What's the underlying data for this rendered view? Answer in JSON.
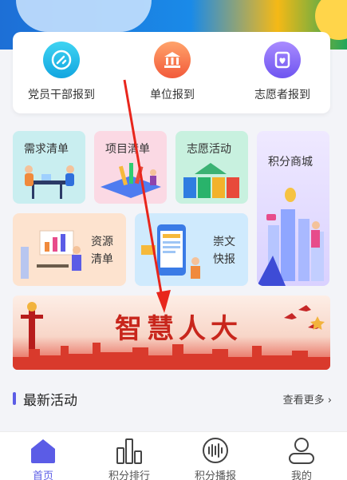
{
  "colors": {
    "accent": "#5b5ce6",
    "arrow": "#e8261c"
  },
  "report": {
    "items": [
      {
        "label": "党员干部报到",
        "icon": "party-member-icon"
      },
      {
        "label": "单位报到",
        "icon": "building-icon"
      },
      {
        "label": "志愿者报到",
        "icon": "volunteer-heart-icon"
      }
    ]
  },
  "tiles": {
    "demand": "需求清单",
    "project": "项目清单",
    "volunteer": "志愿活动",
    "points_mall": "积分商城",
    "resource_line1": "资源",
    "resource_line2": "清单",
    "culture_line1": "崇文",
    "culture_line2": "快报"
  },
  "promo": {
    "title": "智慧人大"
  },
  "section": {
    "title": "最新活动",
    "more": "查看更多"
  },
  "tabbar": {
    "items": [
      {
        "label": "首页",
        "icon": "home-icon",
        "active": true
      },
      {
        "label": "积分排行",
        "icon": "bar-chart-icon",
        "active": false
      },
      {
        "label": "积分播报",
        "icon": "broadcast-icon",
        "active": false
      },
      {
        "label": "我的",
        "icon": "user-icon",
        "active": false
      }
    ]
  }
}
